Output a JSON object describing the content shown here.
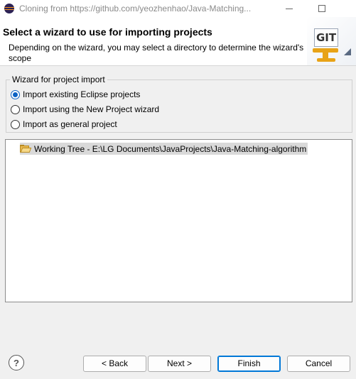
{
  "window": {
    "title": "Cloning from https://github.com/yeozhenhao/Java-Matching..."
  },
  "header": {
    "title": "Select a wizard to use for importing projects",
    "description": "Depending on the wizard, you may select a directory to determine the wizard's scope",
    "logo_text": "GIT"
  },
  "wizard_group": {
    "label": "Wizard for project import",
    "options": [
      {
        "label": "Import existing Eclipse projects",
        "checked": true
      },
      {
        "label": "Import using the New Project wizard",
        "checked": false
      },
      {
        "label": "Import as general project",
        "checked": false
      }
    ]
  },
  "tree": {
    "items": [
      {
        "label": "Working Tree - E:\\LG Documents\\JavaProjects\\Java-Matching-algorithm",
        "icon": "folder-open-icon",
        "selected": true
      }
    ]
  },
  "buttons": {
    "help": "?",
    "back": "< Back",
    "next": "Next >",
    "finish": "Finish",
    "cancel": "Cancel"
  }
}
